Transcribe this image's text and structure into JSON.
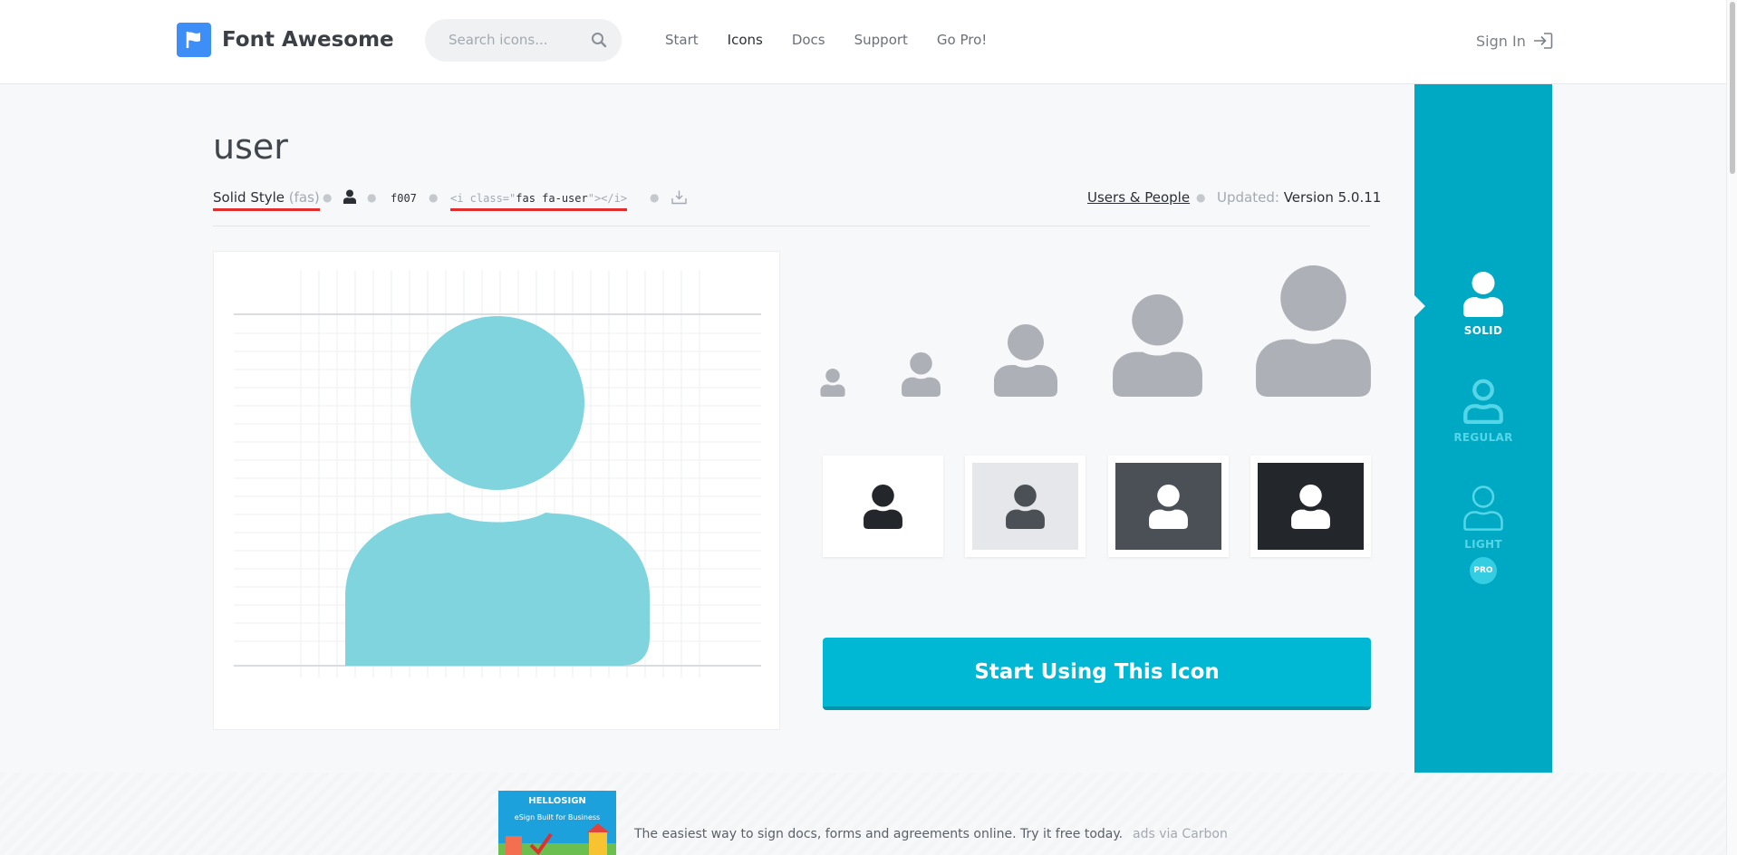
{
  "header": {
    "brand": "Font Awesome",
    "search_placeholder": "Search icons...",
    "nav": [
      {
        "label": "Start"
      },
      {
        "label": "Icons"
      },
      {
        "label": "Docs"
      },
      {
        "label": "Support"
      },
      {
        "label": "Go Pro!"
      }
    ],
    "sign_in": "Sign In"
  },
  "icon": {
    "name": "user",
    "style_label": "Solid Style",
    "style_prefix": "(fas)",
    "unicode": "f007",
    "snippet_open": "<i class=\"",
    "snippet_class": "fas fa-user",
    "snippet_close": "\"></i>",
    "category": "Users & People",
    "updated_label": "Updated:",
    "updated_version": "Version 5.0.11",
    "color": "#7fd4de",
    "gray": "#adb0b7"
  },
  "swatches": [
    {
      "bg": "#ffffff",
      "fg": "#23262b"
    },
    {
      "bg": "#e5e7ea",
      "fg": "#4b4f56"
    },
    {
      "bg": "#4b4f56",
      "fg": "#ffffff"
    },
    {
      "bg": "#23262b",
      "fg": "#ffffff"
    }
  ],
  "cta": "Start Using This Icon",
  "styles": [
    {
      "label": "SOLID"
    },
    {
      "label": "REGULAR"
    },
    {
      "label": "LIGHT",
      "badge": "PRO"
    }
  ],
  "ad": {
    "brand": "HELLOSIGN",
    "tagline": "eSign Built for Business",
    "text": "The easiest way to sign docs, forms and agreements online. Try it free today.",
    "via": "ads via Carbon"
  }
}
